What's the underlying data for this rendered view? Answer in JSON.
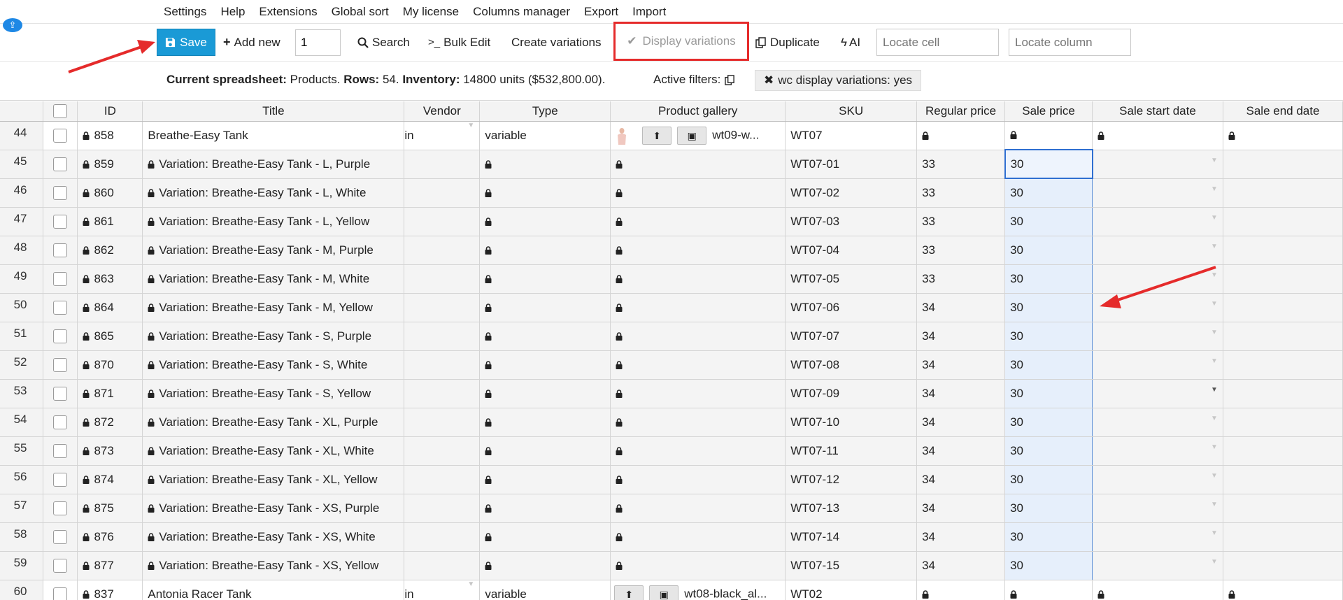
{
  "menu": {
    "items": [
      "Settings",
      "Help",
      "Extensions",
      "Global sort",
      "My license",
      "Columns manager",
      "Export",
      "Import"
    ]
  },
  "toolbar": {
    "save_label": "Save",
    "add_new_label": "Add new",
    "add_count_value": "1",
    "search_label": "Search",
    "bulk_edit_label": "Bulk Edit",
    "create_variations_label": "Create variations",
    "display_variations_label": "Display variations",
    "duplicate_label": "Duplicate",
    "ai_label": "AI",
    "locate_cell_placeholder": "Locate cell",
    "locate_column_placeholder": "Locate column"
  },
  "info": {
    "current_label": "Current spreadsheet:",
    "current_value": " Products.",
    "rows_label": "Rows:",
    "rows_value": " 54.",
    "inventory_label": "Inventory:",
    "inventory_value": " 14800 units ($532,800.00).",
    "active_filters_label": "Active filters:",
    "filter_chip": "wc display variations: yes"
  },
  "columns": [
    "ID",
    "Title",
    "Vendor",
    "Type",
    "Product gallery",
    "SKU",
    "Regular price",
    "Sale price",
    "Sale start date",
    "Sale end date"
  ],
  "rows": [
    {
      "num": "44",
      "id": "858",
      "title": "Breathe-Easy Tank",
      "vendor": "in",
      "type": "variable",
      "gallery": "wt09-w...",
      "sku": "WT07",
      "regular": "",
      "sale": "",
      "parent": true,
      "thumb": true
    },
    {
      "num": "45",
      "id": "859",
      "title": "Variation: Breathe-Easy Tank - L, Purple",
      "sku": "WT07-01",
      "regular": "33",
      "sale": "30"
    },
    {
      "num": "46",
      "id": "860",
      "title": "Variation: Breathe-Easy Tank - L, White",
      "sku": "WT07-02",
      "regular": "33",
      "sale": "30"
    },
    {
      "num": "47",
      "id": "861",
      "title": "Variation: Breathe-Easy Tank - L, Yellow",
      "sku": "WT07-03",
      "regular": "33",
      "sale": "30"
    },
    {
      "num": "48",
      "id": "862",
      "title": "Variation: Breathe-Easy Tank - M, Purple",
      "sku": "WT07-04",
      "regular": "33",
      "sale": "30"
    },
    {
      "num": "49",
      "id": "863",
      "title": "Variation: Breathe-Easy Tank - M, White",
      "sku": "WT07-05",
      "regular": "33",
      "sale": "30"
    },
    {
      "num": "50",
      "id": "864",
      "title": "Variation: Breathe-Easy Tank - M, Yellow",
      "sku": "WT07-06",
      "regular": "34",
      "sale": "30"
    },
    {
      "num": "51",
      "id": "865",
      "title": "Variation: Breathe-Easy Tank - S, Purple",
      "sku": "WT07-07",
      "regular": "34",
      "sale": "30"
    },
    {
      "num": "52",
      "id": "870",
      "title": "Variation: Breathe-Easy Tank - S, White",
      "sku": "WT07-08",
      "regular": "34",
      "sale": "30"
    },
    {
      "num": "53",
      "id": "871",
      "title": "Variation: Breathe-Easy Tank - S, Yellow",
      "sku": "WT07-09",
      "regular": "34",
      "sale": "30"
    },
    {
      "num": "54",
      "id": "872",
      "title": "Variation: Breathe-Easy Tank - XL, Purple",
      "sku": "WT07-10",
      "regular": "34",
      "sale": "30"
    },
    {
      "num": "55",
      "id": "873",
      "title": "Variation: Breathe-Easy Tank - XL, White",
      "sku": "WT07-11",
      "regular": "34",
      "sale": "30"
    },
    {
      "num": "56",
      "id": "874",
      "title": "Variation: Breathe-Easy Tank - XL, Yellow",
      "sku": "WT07-12",
      "regular": "34",
      "sale": "30"
    },
    {
      "num": "57",
      "id": "875",
      "title": "Variation: Breathe-Easy Tank - XS, Purple",
      "sku": "WT07-13",
      "regular": "34",
      "sale": "30"
    },
    {
      "num": "58",
      "id": "876",
      "title": "Variation: Breathe-Easy Tank - XS, White",
      "sku": "WT07-14",
      "regular": "34",
      "sale": "30"
    },
    {
      "num": "59",
      "id": "877",
      "title": "Variation: Breathe-Easy Tank - XS, Yellow",
      "sku": "WT07-15",
      "regular": "34",
      "sale": "30"
    },
    {
      "num": "60",
      "id": "837",
      "title": "Antonia Racer Tank",
      "vendor": "in",
      "type": "variable",
      "gallery": "wt08-black_al...",
      "sku": "WT02",
      "regular": "",
      "sale": "",
      "parent": true,
      "thumb": false
    }
  ],
  "colors": {
    "save_bg": "#1a9ad6",
    "annotation_red": "#e52b2b",
    "selection_blue": "#2f6fd1",
    "selection_fill": "#e6effb"
  },
  "icons": {
    "app": "home-circle-icon",
    "save": "floppy-disk-icon",
    "add": "plus-icon",
    "search": "magnifier-icon",
    "bulk": "terminal-prompt-icon",
    "display_check": "check-icon",
    "duplicate": "copy-icon",
    "ai": "bolt-icon",
    "lock": "lock-icon",
    "filter_copy": "copy-icon",
    "filter_remove": "close-icon"
  }
}
